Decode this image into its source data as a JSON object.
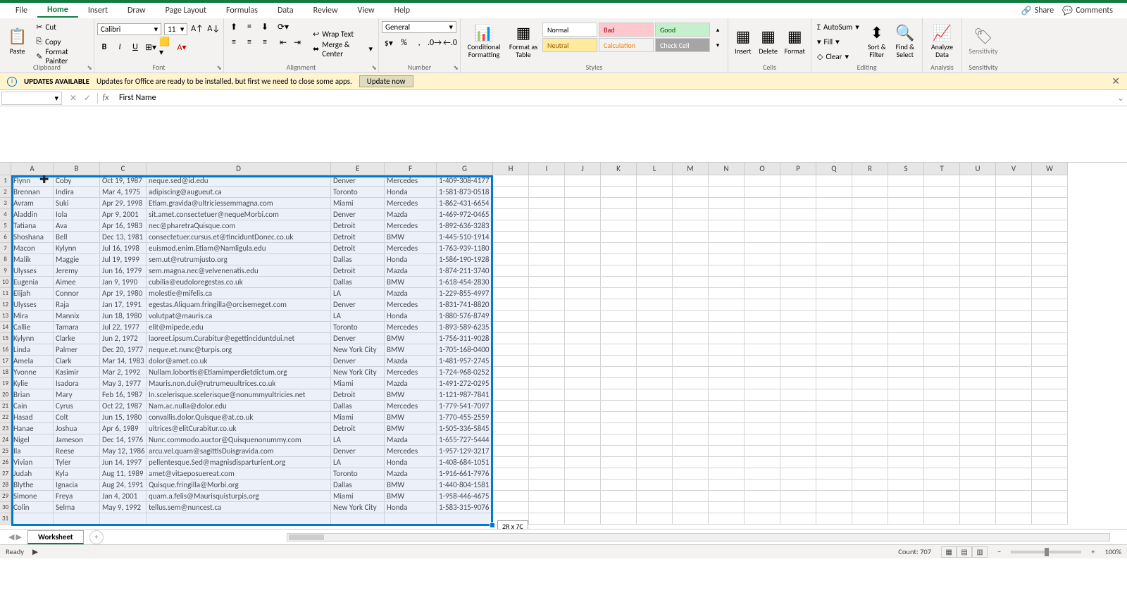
{
  "menu": {
    "tabs": [
      "File",
      "Home",
      "Insert",
      "Draw",
      "Page Layout",
      "Formulas",
      "Data",
      "Review",
      "View",
      "Help"
    ],
    "active": "Home",
    "share": "Share",
    "comments": "Comments"
  },
  "ribbon": {
    "clipboard": {
      "paste": "Paste",
      "cut": "Cut",
      "copy": "Copy",
      "painter": "Format Painter",
      "label": "Clipboard"
    },
    "font": {
      "name": "Calibri",
      "size": "11",
      "label": "Font"
    },
    "alignment": {
      "wrap": "Wrap Text",
      "merge": "Merge & Center",
      "label": "Alignment"
    },
    "number": {
      "format": "General",
      "label": "Number"
    },
    "styles": {
      "cond": "Conditional Formatting",
      "fat": "Format as Table",
      "normal": "Normal",
      "bad": "Bad",
      "good": "Good",
      "neutral": "Neutral",
      "calc": "Calculation",
      "check": "Check Cell",
      "label": "Styles"
    },
    "cells": {
      "insert": "Insert",
      "delete": "Delete",
      "format": "Format",
      "label": "Cells"
    },
    "editing": {
      "sum": "AutoSum",
      "fill": "Fill",
      "clear": "Clear",
      "sort": "Sort & Filter",
      "find": "Find & Select",
      "label": "Editing"
    },
    "analysis": {
      "analyze": "Analyze Data",
      "label": "Analysis"
    },
    "sens": {
      "sens": "Sensitivity",
      "label": "Sensitivity"
    }
  },
  "updatebar": {
    "title": "UPDATES AVAILABLE",
    "msg": "Updates for Office are ready to be installed, but first we need to close some apps.",
    "btn": "Update now"
  },
  "formulabar": {
    "namebox": "",
    "value": "First Name"
  },
  "columns": [
    "A",
    "B",
    "C",
    "D",
    "E",
    "F",
    "G",
    "H",
    "I",
    "J",
    "K",
    "L",
    "M",
    "N",
    "O",
    "P",
    "Q",
    "R",
    "S",
    "T",
    "U",
    "V",
    "W"
  ],
  "col_widths": [
    "cwA",
    "cwB",
    "cwC",
    "cwD",
    "cwE",
    "cwF",
    "cwG"
  ],
  "selection": {
    "tooltip": "2R x 7C"
  },
  "rows": [
    [
      "Flynn",
      "Coby",
      "Oct 19, 1987",
      "neque.sed@id.edu",
      "Denver",
      "Mercedes",
      "1-409-308-4177"
    ],
    [
      "Brennan",
      "Indira",
      "Mar 4, 1975",
      "adipiscing@augueut.ca",
      "Toronto",
      "Honda",
      "1-581-873-0518"
    ],
    [
      "Avram",
      "Suki",
      "Apr 29, 1998",
      "Etiam.gravida@ultriciessemmagna.com",
      "Miami",
      "Mercedes",
      "1-862-431-6654"
    ],
    [
      "Aladdin",
      "Iola",
      "Apr 9, 2001",
      "sit.amet.consectetuer@nequeMorbi.com",
      "Denver",
      "Mazda",
      "1-469-972-0465"
    ],
    [
      "Tatiana",
      "Ava",
      "Apr 16, 1983",
      "nec@pharetraQuisque.com",
      "Detroit",
      "Mercedes",
      "1-892-636-3283"
    ],
    [
      "Shoshana",
      "Bell",
      "Dec 13, 1981",
      "consectetuer.cursus.et@tinciduntDonec.co.uk",
      "Detroit",
      "BMW",
      "1-445-510-1914"
    ],
    [
      "Macon",
      "Kylynn",
      "Jul 16, 1998",
      "euismod.enim.Etiam@Namligula.edu",
      "Detroit",
      "Mercedes",
      "1-763-939-1180"
    ],
    [
      "Malik",
      "Maggie",
      "Jul 19, 1999",
      "sem.ut@rutrumjusto.org",
      "Dallas",
      "Honda",
      "1-586-190-1928"
    ],
    [
      "Ulysses",
      "Jeremy",
      "Jun 16, 1979",
      "sem.magna.nec@velvenenatis.edu",
      "Detroit",
      "Mazda",
      "1-874-211-3740"
    ],
    [
      "Eugenia",
      "Aimee",
      "Jan 9, 1990",
      "cubilia@eudoloregestas.co.uk",
      "Dallas",
      "BMW",
      "1-618-454-2830"
    ],
    [
      "Elijah",
      "Connor",
      "Apr 19, 1980",
      "molestie@mifelis.ca",
      "LA",
      "Mazda",
      "1-229-855-4997"
    ],
    [
      "Ulysses",
      "Raja",
      "Jan 17, 1991",
      "egestas.Aliquam.fringilla@orcisemeget.com",
      "Denver",
      "Mercedes",
      "1-831-741-8820"
    ],
    [
      "Mira",
      "Mannix",
      "Jun 18, 1980",
      "volutpat@mauris.ca",
      "LA",
      "Honda",
      "1-880-576-8749"
    ],
    [
      "Callie",
      "Tamara",
      "Jul 22, 1977",
      "elit@mipede.edu",
      "Toronto",
      "Mercedes",
      "1-893-589-6235"
    ],
    [
      "Kylynn",
      "Clarke",
      "Jun 2, 1972",
      "laoreet.ipsum.Curabitur@egettinciduntdui.net",
      "Denver",
      "BMW",
      "1-756-311-9028"
    ],
    [
      "Linda",
      "Palmer",
      "Dec 20, 1977",
      "neque.et.nunc@turpis.org",
      "New York City",
      "BMW",
      "1-705-168-0400"
    ],
    [
      "Amela",
      "Clark",
      "Mar 14, 1983",
      "dolor@amet.co.uk",
      "Denver",
      "Mazda",
      "1-481-957-2745"
    ],
    [
      "Yvonne",
      "Kasimir",
      "Mar 2, 1992",
      "Nullam.lobortis@Etiamimperdietdictum.org",
      "New York City",
      "Mercedes",
      "1-724-968-0252"
    ],
    [
      "Kylie",
      "Isadora",
      "May 3, 1977",
      "Mauris.non.dui@rutrumeuultrices.co.uk",
      "Miami",
      "Mazda",
      "1-491-272-0295"
    ],
    [
      "Brian",
      "Mary",
      "Feb 16, 1987",
      "In.scelerisque.scelerisque@nonummyultricies.net",
      "Detroit",
      "BMW",
      "1-121-987-7841"
    ],
    [
      "Cain",
      "Cyrus",
      "Oct 22, 1987",
      "Nam.ac.nulla@dolor.edu",
      "Dallas",
      "Mercedes",
      "1-779-541-7097"
    ],
    [
      "Hasad",
      "Colt",
      "Jun 15, 1980",
      "convallis.dolor.Quisque@at.co.uk",
      "Miami",
      "BMW",
      "1-770-455-2559"
    ],
    [
      "Hanae",
      "Joshua",
      "Apr 6, 1989",
      "ultrices@elitCurabitur.co.uk",
      "Detroit",
      "BMW",
      "1-505-336-5845"
    ],
    [
      "Nigel",
      "Jameson",
      "Dec 14, 1976",
      "Nunc.commodo.auctor@Quisquenonummy.com",
      "LA",
      "Mazda",
      "1-655-727-5444"
    ],
    [
      "Ila",
      "Reese",
      "May 12, 1986",
      "arcu.vel.quam@sagittisDuisgravida.com",
      "Denver",
      "Mercedes",
      "1-957-129-3217"
    ],
    [
      "Vivian",
      "Tyler",
      "Jun 14, 1997",
      "pellentesque.Sed@magnisdisparturient.org",
      "LA",
      "Honda",
      "1-408-684-1051"
    ],
    [
      "Judah",
      "Kyla",
      "Aug 11, 1989",
      "amet@vitaeposuereat.com",
      "Toronto",
      "Mazda",
      "1-916-661-7976"
    ],
    [
      "Blythe",
      "Ignacia",
      "Aug 24, 1991",
      "Quisque.fringilla@Morbi.org",
      "Dallas",
      "BMW",
      "1-440-804-1581"
    ],
    [
      "Simone",
      "Freya",
      "Jan 4, 2001",
      "quam.a.felis@Maurisquisturpis.org",
      "Miami",
      "BMW",
      "1-958-446-4675"
    ],
    [
      "Colin",
      "Selma",
      "May 9, 1992",
      "tellus.sem@nuncest.ca",
      "New York City",
      "Honda",
      "1-583-315-9076"
    ]
  ],
  "sheet": {
    "name": "Worksheet"
  },
  "status": {
    "ready": "Ready",
    "count": "Count: 707",
    "zoom": "100%"
  }
}
